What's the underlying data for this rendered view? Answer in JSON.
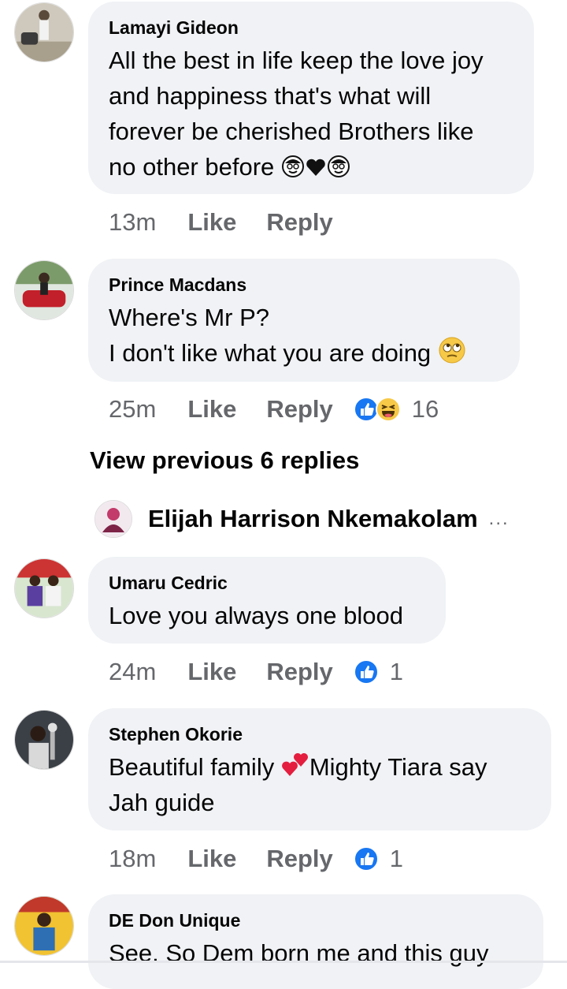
{
  "comments": [
    {
      "author": "Lamayi Gideon",
      "text_lines": [
        "All the best in life keep the love joy",
        "and happiness that's what will",
        "forever be cherished Brothers like",
        "no other before"
      ],
      "time": "13m",
      "like": "Like",
      "reply": "Reply"
    },
    {
      "author": "Prince Macdans",
      "text_lines": [
        "Where's Mr P?",
        "I don't like what you are doing"
      ],
      "time": "25m",
      "like": "Like",
      "reply": "Reply",
      "reaction_count": "16"
    },
    {
      "author": "Umaru Cedric",
      "text_lines": [
        "Love you always one blood"
      ],
      "time": "24m",
      "like": "Like",
      "reply": "Reply",
      "reaction_count": "1"
    },
    {
      "author": "Stephen Okorie",
      "text_lines": [
        "Beautiful family",
        "Mighty Tiara say",
        "Jah guide"
      ],
      "time": "18m",
      "like": "Like",
      "reply": "Reply",
      "reaction_count": "1"
    },
    {
      "author": "DE Don Unique",
      "text_lines": [
        "See. So Dem born me and this guy"
      ]
    }
  ],
  "view_previous": "View previous 6 replies",
  "reply_thread": {
    "name": "Elijah Harrison Nkemakolam",
    "more": "..."
  },
  "colors": {
    "bubble": "#f0f2f5",
    "meta": "#65676b",
    "like_blue": "#1877f2"
  },
  "icons": {
    "like_reaction": "thumbs-up-icon",
    "haha_reaction": "laughing-face-icon",
    "eye_roll_emoji": "eye-roll-emoji-icon",
    "heart_emoji": "heart-emoji-icon",
    "smiley_face_emoji": "smiley-face-emoji-icon",
    "two_hearts_emoji": "two-hearts-emoji-icon"
  }
}
